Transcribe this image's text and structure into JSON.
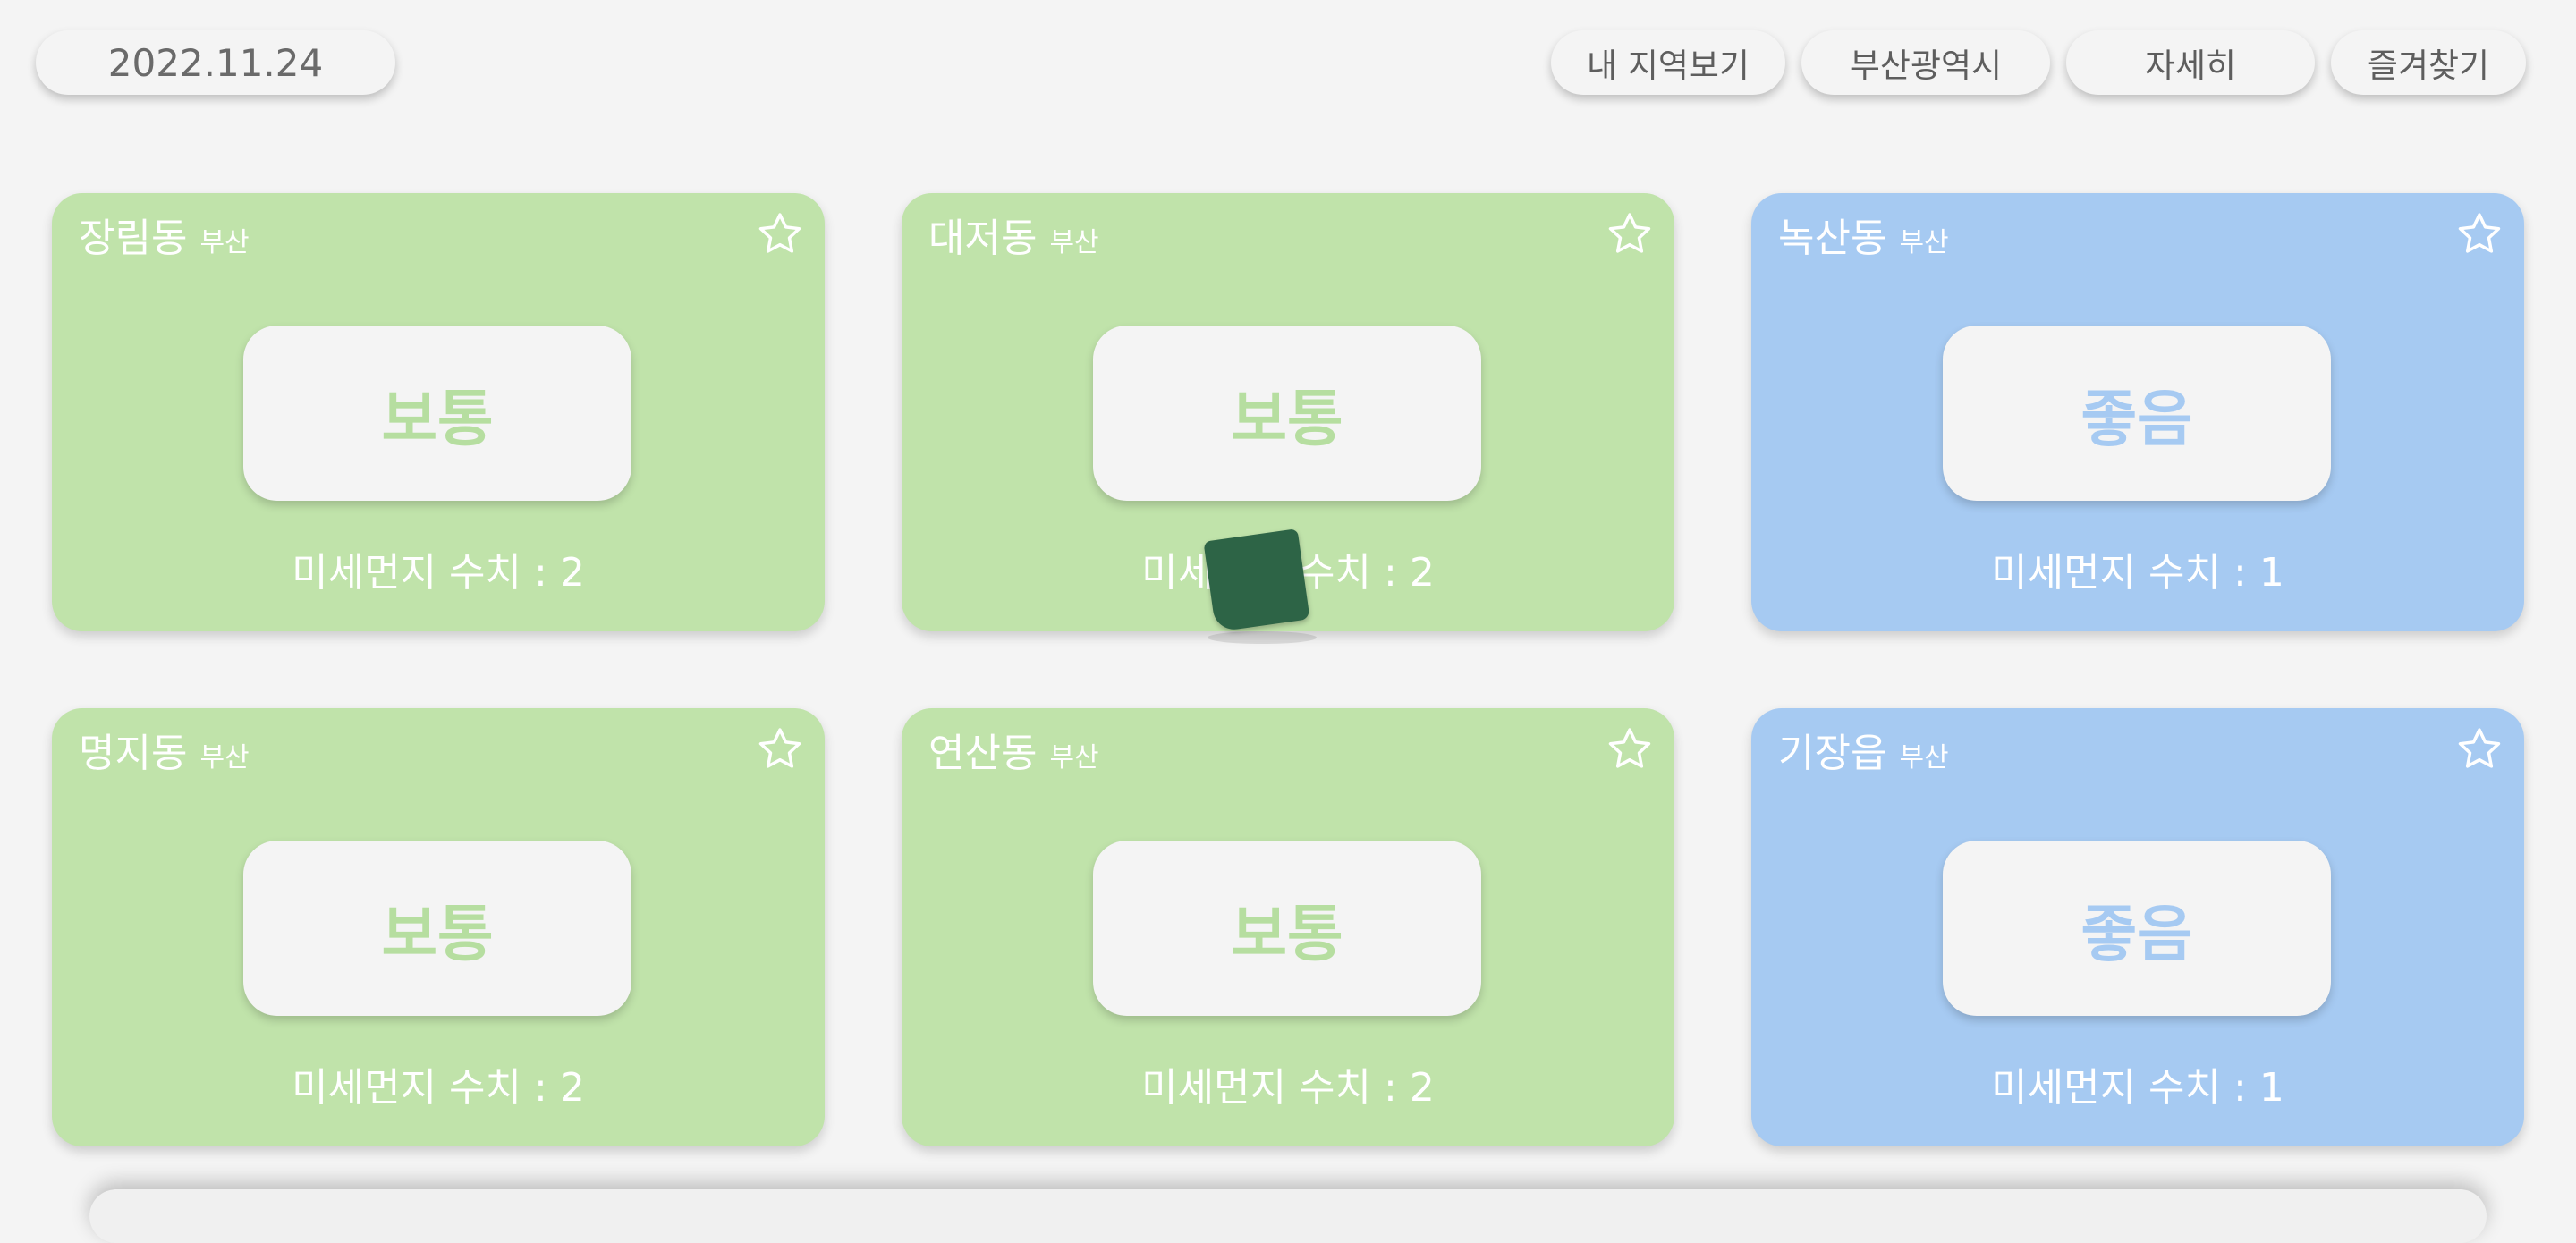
{
  "header": {
    "date": "2022.11.24",
    "nav": [
      {
        "label": "내 지역보기",
        "name": "my-region-button"
      },
      {
        "label": "부산광역시",
        "name": "busan-city-button"
      },
      {
        "label": "자세히",
        "name": "details-button"
      },
      {
        "label": "즐겨찾기",
        "name": "favorites-button"
      }
    ]
  },
  "cards": [
    {
      "name": "장림동",
      "region": "부산",
      "status": "보통",
      "pm_label": "미세먼지 수치 : ",
      "pm_value": "2",
      "color": "#c0e3aa"
    },
    {
      "name": "대저동",
      "region": "부산",
      "status": "보통",
      "pm_label": "미세먼지 수치 : ",
      "pm_value": "2",
      "color": "#c0e3aa"
    },
    {
      "name": "녹산동",
      "region": "부산",
      "status": "좋음",
      "pm_label": "미세먼지 수치 : ",
      "pm_value": "1",
      "color": "#a6caf2"
    },
    {
      "name": "명지동",
      "region": "부산",
      "status": "보통",
      "pm_label": "미세먼지 수치 : ",
      "pm_value": "2",
      "color": "#c0e3aa"
    },
    {
      "name": "연산동",
      "region": "부산",
      "status": "보통",
      "pm_label": "미세먼지 수치 : ",
      "pm_value": "2",
      "color": "#c0e3aa"
    },
    {
      "name": "기장읍",
      "region": "부산",
      "status": "좋음",
      "pm_label": "미세먼지 수치 : ",
      "pm_value": "1",
      "color": "#a6caf2"
    }
  ],
  "icons": {
    "favorite": "star-outline-icon"
  }
}
